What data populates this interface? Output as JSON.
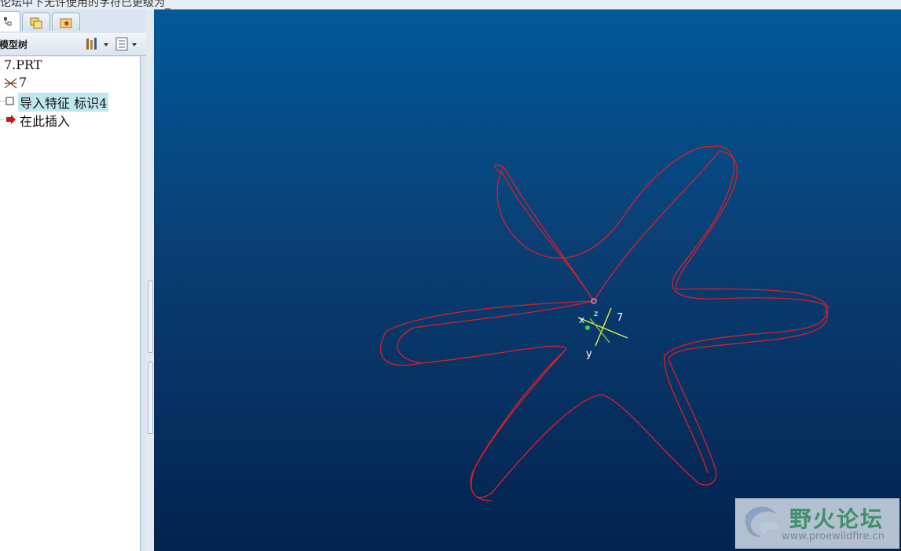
{
  "window": {
    "title_fragment": "论坛中下无许使用的字符已更级为_"
  },
  "navigator": {
    "tabs": [
      {
        "icon": "model-tree-icon",
        "active": true
      },
      {
        "icon": "folder-browser-icon",
        "active": false
      },
      {
        "icon": "favorites-icon",
        "active": false
      }
    ],
    "tree_title": "模型树",
    "toolbar": {
      "settings_icon": "tree-settings-icon",
      "show_icon": "tree-columns-icon"
    },
    "tree": [
      {
        "label": "7.PRT",
        "icon": ""
      },
      {
        "label": "7",
        "icon": "csys-icon"
      },
      {
        "label": "导入特征 标识4",
        "icon": "import-feature-icon",
        "selected": true
      },
      {
        "label": "在此插入",
        "icon": "insert-here-arrow-icon"
      }
    ]
  },
  "viewport": {
    "background_top": "#00599a",
    "background_bottom": "#03234f",
    "curve_color": "#d8202a",
    "csys_color": "#e6f040",
    "axis_labels": {
      "x": "x",
      "y": "y",
      "z": "z"
    }
  },
  "watermark": {
    "text": "野火论坛",
    "url": "www.proewildfire.cn"
  }
}
